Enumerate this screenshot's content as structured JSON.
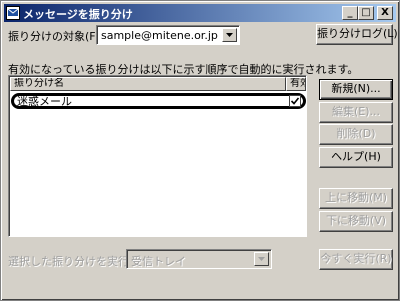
{
  "window": {
    "title": "メッセージを振り分け"
  },
  "titlebar": {
    "min": "_",
    "max": "□",
    "close": "X"
  },
  "target": {
    "label": "振り分けの対象(F):",
    "value": "sample@mitene.or.jp"
  },
  "log_button": "振り分けログ(L)",
  "description": "有効になっている振り分けは以下に示す順序で自動的に実行されます。",
  "list": {
    "columns": [
      "振り分け名",
      "有効"
    ],
    "rows": [
      {
        "name": "迷惑メール",
        "enabled": true
      }
    ]
  },
  "buttons": {
    "new": "新規(N)...",
    "edit": "編集(E)...",
    "delete": "削除(D)",
    "help": "ヘルプ(H)",
    "move_up": "上に移動(M)",
    "move_down": "下に移動(V)",
    "run_now": "今すぐ実行(R)"
  },
  "run": {
    "label": "選択した振り分けを実行(I):",
    "value": "受信トレイ"
  },
  "colors": {
    "face": "#d4d0c8",
    "title_start": "#0a246a",
    "title_end": "#a6caf0",
    "disabled_text": "#a0a0a0"
  }
}
